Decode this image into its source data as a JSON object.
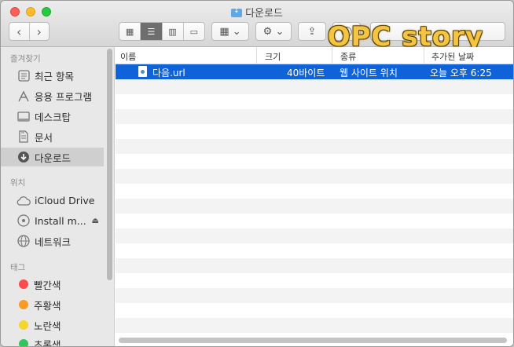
{
  "window": {
    "title": "다운로드",
    "brand_overlay": "OPC story"
  },
  "toolbar": {
    "back_label": "‹",
    "forward_label": "›",
    "view_icon_label": "▦",
    "view_list_label": "☰",
    "view_column_label": "▥",
    "view_gallery_label": "▭",
    "arrange_label": "▦ ⌄",
    "action_label": "⚙ ⌄",
    "share_label": "⇪",
    "tag_label": "◯"
  },
  "sidebar": {
    "favorites_heading": "즐겨찾기",
    "favorites": [
      {
        "label": "최근 항목",
        "icon": "clock-icon"
      },
      {
        "label": "응용 프로그램",
        "icon": "applications-icon"
      },
      {
        "label": "데스크탑",
        "icon": "desktop-icon"
      },
      {
        "label": "문서",
        "icon": "document-icon"
      },
      {
        "label": "다운로드",
        "icon": "download-icon"
      }
    ],
    "locations_heading": "위치",
    "locations": [
      {
        "label": "iCloud Drive",
        "icon": "cloud-icon"
      },
      {
        "label": "Install m...",
        "icon": "disk-icon"
      },
      {
        "label": "네트워크",
        "icon": "network-icon"
      }
    ],
    "tags_heading": "태그",
    "tags": [
      {
        "label": "빨간색",
        "color": "#fc4c4c"
      },
      {
        "label": "주황색",
        "color": "#f99b28"
      },
      {
        "label": "노란색",
        "color": "#f7d52c"
      },
      {
        "label": "초록색",
        "color": "#36c45a"
      }
    ]
  },
  "list": {
    "columns": {
      "name": "이름",
      "size": "크기",
      "kind": "종류",
      "date_added": "추가된 날짜"
    },
    "files": [
      {
        "name": "다음.url",
        "size": "40바이트",
        "kind": "웹 사이트 위치",
        "date_added": "오늘 오후 6:25"
      }
    ]
  },
  "colors": {
    "selection": "#1062d9",
    "sidebar_bg": "#e8e8e8"
  }
}
